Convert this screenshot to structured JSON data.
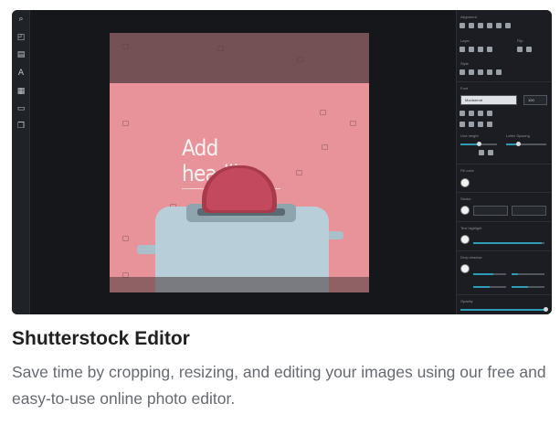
{
  "preview": {
    "left_tools": [
      "search-icon",
      "crop-icon",
      "layers-icon",
      "text-icon",
      "grid-icon",
      "frame-icon",
      "stack-icon"
    ],
    "tool_glyphs": [
      "⌕",
      "◰",
      "▤",
      "A",
      "▦",
      "▭",
      "❐"
    ],
    "canvas": {
      "headline": "Add headline",
      "background_color": "#e8929a"
    },
    "panel": {
      "sections": {
        "alignment": "Alignment",
        "layer": "Layer",
        "flip": "Flip",
        "style": "Style",
        "font": "Font",
        "line_height": "Line height",
        "letter_spacing": "Letter Spacing",
        "fill_color": "Fill color",
        "stroke": "Stroke",
        "text_highlight": "Text highlight",
        "drop_shadow": "Drop shadow",
        "opacity": "Opacity"
      },
      "font_select": "Montserrat",
      "size_select": "100",
      "accent_color": "#2f9cb5"
    }
  },
  "card": {
    "title": "Shutterstock Editor",
    "description": "Save time by cropping, resizing, and editing your images using our free and easy-to-use online photo editor."
  }
}
